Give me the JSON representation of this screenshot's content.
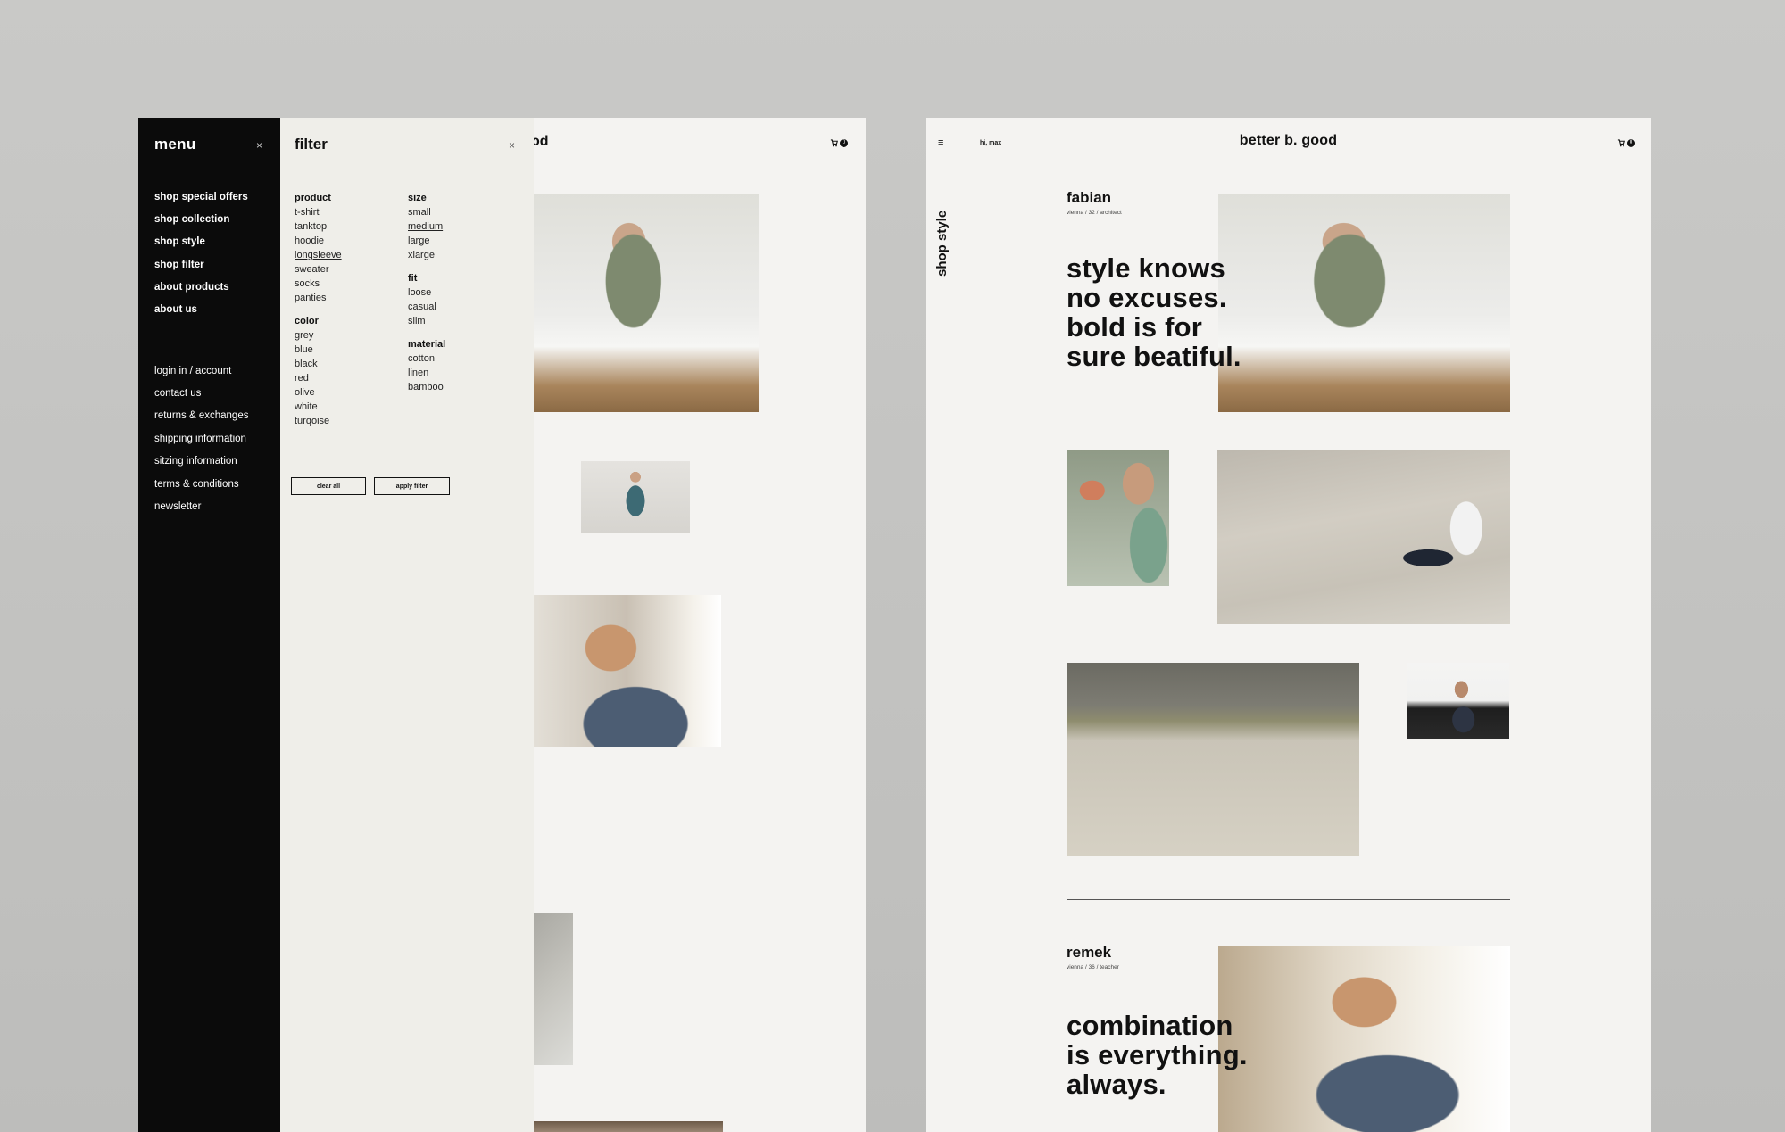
{
  "left_mockup": {
    "menu": {
      "title": "menu",
      "close_icon": "×",
      "primary_links": [
        "shop special offers",
        "shop collection",
        "shop style",
        "shop filter",
        "about products",
        "about us"
      ],
      "active_link": "shop filter",
      "secondary_links": [
        "login in / account",
        "contact us",
        "returns & exchanges",
        "shipping information",
        "sitzing information",
        "terms & conditions",
        "newsletter"
      ]
    },
    "filter": {
      "title": "filter",
      "close_icon": "×",
      "groups": {
        "product": {
          "label": "product",
          "options": [
            "t-shirt",
            "tanktop",
            "hoodie",
            "longsleeve",
            "sweater",
            "socks",
            "panties"
          ],
          "selected": "longsleeve"
        },
        "color": {
          "label": "color",
          "options": [
            "grey",
            "blue",
            "black",
            "red",
            "olive",
            "white",
            "turqoise"
          ],
          "selected": "black"
        },
        "size": {
          "label": "size",
          "options": [
            "small",
            "medium",
            "large",
            "xlarge"
          ],
          "selected": "medium"
        },
        "fit": {
          "label": "fit",
          "options": [
            "loose",
            "casual",
            "slim"
          ]
        },
        "material": {
          "label": "material",
          "options": [
            "cotton",
            "linen",
            "bamboo"
          ]
        }
      },
      "clear_label": "clear all",
      "apply_label": "apply filter"
    },
    "brand_fragment": "od",
    "cart_count": "0"
  },
  "right_mockup": {
    "hamburger_icon": "≡",
    "greeting": "hi, max",
    "brand": "better b. good",
    "cart_count": "0",
    "section_label": "shop style",
    "person1": {
      "name": "fabian",
      "meta": "vienna / 32 / architect",
      "headline_lines": [
        "style knows",
        "no excuses.",
        "bold is for",
        "sure beatiful."
      ]
    },
    "person2": {
      "name": "remek",
      "meta": "vienna / 36 / teacher",
      "headline_lines": [
        "combination",
        "is everything.",
        "always."
      ]
    }
  },
  "colors": {
    "background": "#c3c3c1",
    "page": "#f4f3f1",
    "menu_bg": "#0b0b0b",
    "filter_bg": "#efeee9",
    "text": "#111111"
  },
  "icons": [
    "close-icon",
    "cart-icon",
    "hamburger-icon"
  ]
}
